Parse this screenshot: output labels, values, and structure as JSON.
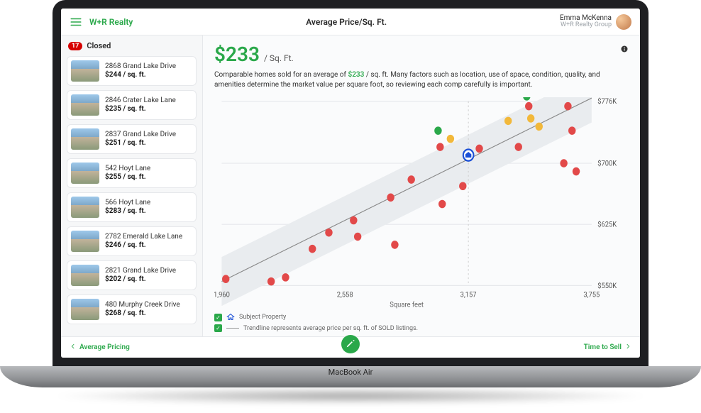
{
  "header": {
    "brand": "W+R Realty",
    "page_title": "Average Price/Sq. Ft.",
    "user_name": "Emma McKenna",
    "user_group": "W+R Realty Group"
  },
  "sidebar": {
    "badge_count": "17",
    "status_label": "Closed",
    "items": [
      {
        "address": "2868 Grand Lake Drive",
        "price": "$244 / sq. ft."
      },
      {
        "address": "2846 Crater Lake Lane",
        "price": "$235 / sq. ft."
      },
      {
        "address": "2837 Grand Lake Drive",
        "price": "$251 / sq. ft."
      },
      {
        "address": "542 Hoyt Lane",
        "price": "$255 / sq. ft."
      },
      {
        "address": "566 Hoyt Lane",
        "price": "$283 / sq. ft."
      },
      {
        "address": "2782 Emerald Lake Lane",
        "price": "$246 / sq. ft."
      },
      {
        "address": "2821 Grand Lake Drive",
        "price": "$202 / sq. ft."
      },
      {
        "address": "480 Murphy Creek Drive",
        "price": "$268 / sq. ft."
      }
    ]
  },
  "kpi": {
    "value": "$233",
    "unit": "/ Sq. Ft."
  },
  "description": {
    "prefix": "Comparable homes sold for an average of ",
    "accent": "$233",
    "suffix": " / sq. ft. Many factors such as location, use of space, condition, quality, and amenities determine the market value per square foot, so reviewing each comp carefully is important."
  },
  "chart_data": {
    "type": "scatter",
    "title": "Average Price/Sq. Ft.",
    "xlabel": "Square feet",
    "ylabel": "",
    "xlim": [
      1960,
      3755
    ],
    "ylim": [
      550000,
      776000
    ],
    "x_ticks": [
      1960,
      2558,
      3157,
      3755
    ],
    "y_ticks": [
      {
        "value": 550000,
        "label": "$550K"
      },
      {
        "value": 625000,
        "label": "$625K"
      },
      {
        "value": 700000,
        "label": "$700K"
      },
      {
        "value": 776000,
        "label": "$776K"
      }
    ],
    "subject": {
      "x": 3157,
      "y": 710000
    },
    "trendline": {
      "x1": 1960,
      "y1": 555000,
      "x2": 3755,
      "y2": 780000
    },
    "band_offset": 30000,
    "series": [
      {
        "name": "sold",
        "color": "#e24949",
        "points": [
          {
            "x": 1980,
            "y": 558000
          },
          {
            "x": 2200,
            "y": 555000
          },
          {
            "x": 2270,
            "y": 560000
          },
          {
            "x": 2400,
            "y": 595000
          },
          {
            "x": 2480,
            "y": 615000
          },
          {
            "x": 2600,
            "y": 630000
          },
          {
            "x": 2620,
            "y": 610000
          },
          {
            "x": 2780,
            "y": 658000
          },
          {
            "x": 2800,
            "y": 600000
          },
          {
            "x": 2880,
            "y": 680000
          },
          {
            "x": 3020,
            "y": 720000
          },
          {
            "x": 3030,
            "y": 650000
          },
          {
            "x": 3130,
            "y": 672000
          },
          {
            "x": 3210,
            "y": 718000
          },
          {
            "x": 3400,
            "y": 720000
          },
          {
            "x": 3450,
            "y": 770000
          },
          {
            "x": 3620,
            "y": 700000
          },
          {
            "x": 3640,
            "y": 770000
          },
          {
            "x": 3660,
            "y": 740000
          },
          {
            "x": 3680,
            "y": 690000
          }
        ]
      },
      {
        "name": "alt",
        "color": "#f2b83a",
        "points": [
          {
            "x": 3070,
            "y": 730000
          },
          {
            "x": 3350,
            "y": 752000
          },
          {
            "x": 3460,
            "y": 755000
          },
          {
            "x": 3500,
            "y": 745000
          }
        ]
      },
      {
        "name": "alt2",
        "color": "#2aa84a",
        "points": [
          {
            "x": 3010,
            "y": 740000
          },
          {
            "x": 3440,
            "y": 782000
          }
        ]
      }
    ]
  },
  "legend": {
    "subject": "Subject Property",
    "trendline": "Trendline represents average price per sq. ft. of SOLD listings."
  },
  "footer": {
    "prev": "Average Pricing",
    "next": "Time to Sell"
  },
  "device": {
    "label": "MacBook Air"
  }
}
